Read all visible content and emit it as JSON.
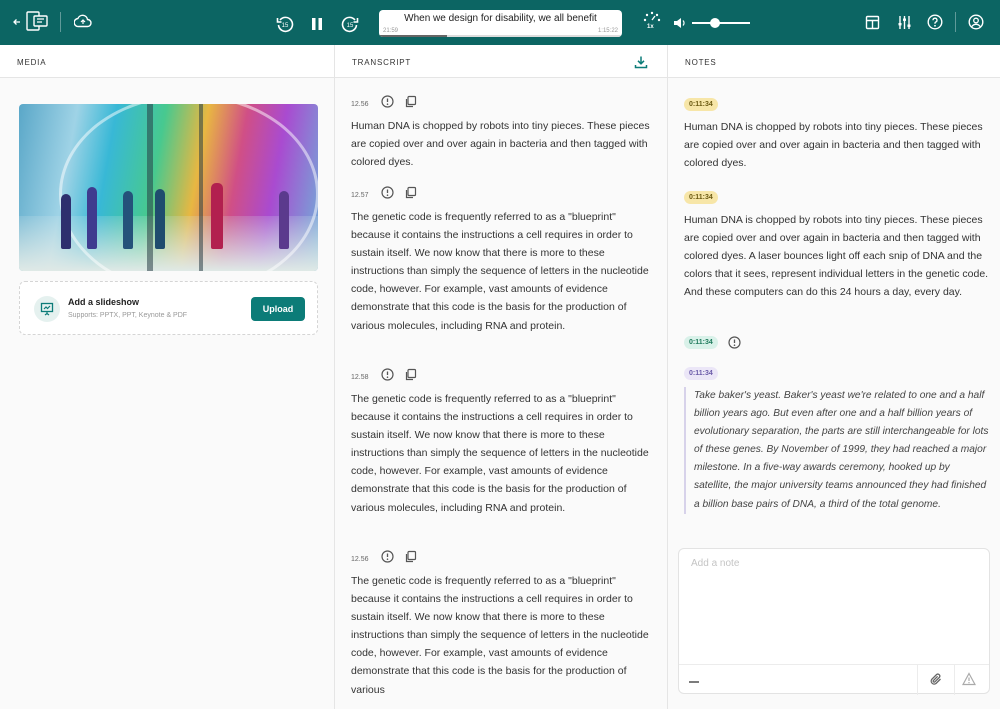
{
  "player": {
    "title": "When we design for disability, we all benefit",
    "time_elapsed": "21:59",
    "time_total": "1:15:22",
    "progress": 0.28,
    "speed": "1x",
    "volume": 0.4,
    "skip_back_seconds": "15",
    "skip_forward_seconds": "15"
  },
  "columns": {
    "media": "MEDIA",
    "transcript": "TRANSCRIPT",
    "notes": "NOTES"
  },
  "media": {
    "slideshow_title": "Add a slideshow",
    "slideshow_sub": "Supports: PPTX, PPT,  Keynote & PDF",
    "upload_label": "Upload"
  },
  "transcript": [
    {
      "time": "12.56",
      "text": "Human DNA is chopped by robots into tiny pieces. These pieces are copied over and over again in bacteria and then tagged with colored dyes."
    },
    {
      "time": "12.57",
      "text": "The genetic code is frequently referred to as a \"blueprint\" because it contains the instructions a cell requires in order to sustain itself. We now know that there is more to these instructions than simply the sequence of letters in the nucleotide code, however. For example, vast amounts of evidence demonstrate that this code is the basis for the production of various molecules, including RNA and protein."
    },
    {
      "time": "12.58",
      "text": "The genetic code is frequently referred to as a \"blueprint\" because it contains the instructions a cell requires in order to sustain itself. We now know that there is more to these instructions than simply the sequence of letters in the nucleotide code, however. For example, vast amounts of evidence demonstrate that this code is the basis for the production of various molecules, including RNA and protein."
    },
    {
      "time": "12.56",
      "text": "The genetic code is frequently referred to as a \"blueprint\" because it contains the instructions a cell requires in order to sustain itself. We now know that there is more to these instructions than simply the sequence of letters in the nucleotide code, however. For example, vast amounts of evidence demonstrate that this code is the basis for the production of various"
    }
  ],
  "notes": [
    {
      "tag": "0:11:34",
      "tag_color": "#f7e6a8",
      "tag_text_color": "#6b5a12",
      "text": "Human DNA is chopped by robots into tiny pieces. These pieces are copied over and over again in bacteria and then tagged with colored dyes."
    },
    {
      "tag": "0:11:34",
      "tag_color": "#f7e6a8",
      "tag_text_color": "#6b5a12",
      "text": "Human DNA is chopped by robots into tiny pieces. These pieces are copied over and over again in bacteria and then tagged with colored dyes. A laser bounces light off each snip of DNA and the colors that it sees, represent individual letters in the genetic code. And these computers can do this 24 hours a day, every day."
    },
    {
      "tag": "0:11:34",
      "tag_color": "#d9f1e9",
      "tag_text_color": "#1f7a5c",
      "text": ""
    },
    {
      "tag": "0:11:34",
      "tag_color": "#ebe6f7",
      "tag_text_color": "#6a5aa8",
      "text": "Take baker's yeast. Baker's yeast we're related to one and a half billion years ago. But even after one and a half billion years of evolutionary separation, the parts are still interchangeable for lots of these genes. By November of 1999, they had reached a major milestone. In a five-way awards ceremony, hooked up by satellite, the major university teams announced they had finished a billion base pairs of DNA, a third of the total genome."
    }
  ],
  "note_input": {
    "placeholder": "Add a note"
  },
  "colors": {
    "topbar": "#0c6563",
    "accent": "#0c7c78"
  }
}
